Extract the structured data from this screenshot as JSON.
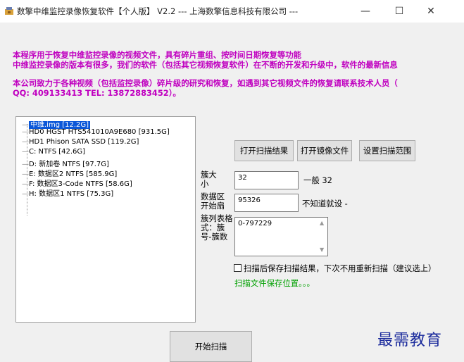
{
  "window": {
    "title": "数擎中维监控录像恢复软件【个人版】 V2.2 --- 上海数擎信息科技有限公司 ---",
    "minimize": "—",
    "maximize": "☐",
    "close": "✕"
  },
  "info_lines": [
    "本程序用于恢复中维监控录像的视频文件，具有碎片重组、按时间日期恢复等功能",
    "中维监控录像的版本有很多，我们的软件（包括其它视频恢复软件）在不断的开发和升级中，软件的最新信息",
    "本公司致力于各种视频（包括监控录像）碎片级的研究和恢复，如遇到其它视频文件的恢复请联系技术人员（",
    "QQ: 409133413 TEL: 13872883452）。"
  ],
  "tree": {
    "selected": "中维.img  [12.2G]",
    "items": [
      "HD0  HGST HTS541010A9E680  [931.5G]",
      "HD1  Phison SATA SSD  [119.2G]",
      "C:   NTFS  [42.6G]",
      "D:  新加卷  NTFS  [97.7G]",
      "E:  数据区2  NTFS  [585.9G]",
      "F:  数据区3-Code  NTFS  [58.6G]",
      "H:  数据区1  NTFS  [75.3G]"
    ]
  },
  "buttons": {
    "open_scan_result": "打开扫描结果",
    "open_image": "打开镜像文件",
    "set_scan_range": "设置扫描范围",
    "start_scan": "开始扫描"
  },
  "cluster": {
    "label": "簇大小",
    "value": "32",
    "hint": "一般 32"
  },
  "start_sector": {
    "label": "数据区开始扇",
    "value": "95326",
    "hint": "不知道就设 -"
  },
  "cluster_list": {
    "label": "簇列表格式：簇号-簇数",
    "value": "0-797229"
  },
  "save_option": {
    "label": "扫描后保存扫描结果，下次不用重新扫描（建议选上）",
    "checked": false
  },
  "save_location": "扫描文件保存位置。。。",
  "watermark": "最需教育"
}
